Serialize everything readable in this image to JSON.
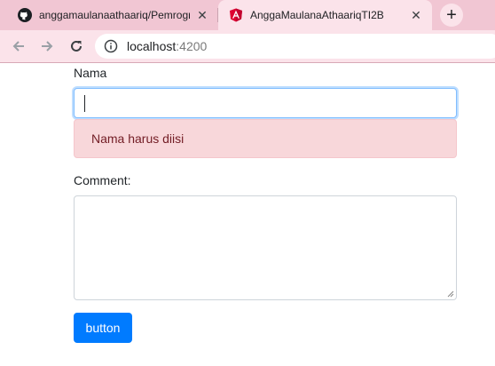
{
  "browser": {
    "tabs": [
      {
        "title": "anggamaulanaathaariq/Pemrogra",
        "favicon": "github-icon",
        "close": "✕"
      },
      {
        "title": "AnggaMaulanaAthaariqTI2B",
        "favicon": "angular-icon",
        "close": "✕"
      }
    ],
    "new_tab": "+",
    "address": {
      "host": "localhost",
      "port": ":4200"
    },
    "colors": {
      "tabbar": "#f1c6d3",
      "toolbar": "#fbe3ea"
    }
  },
  "form": {
    "nama_label": "Nama",
    "nama_value": "",
    "nama_error": "Nama harus diisi",
    "comment_label": "Comment:",
    "comment_value": "",
    "submit_label": "button"
  },
  "colors": {
    "primary": "#007bff",
    "error_bg": "#f8d7da",
    "error_text": "#721c24",
    "focus_border": "#80bdff"
  }
}
